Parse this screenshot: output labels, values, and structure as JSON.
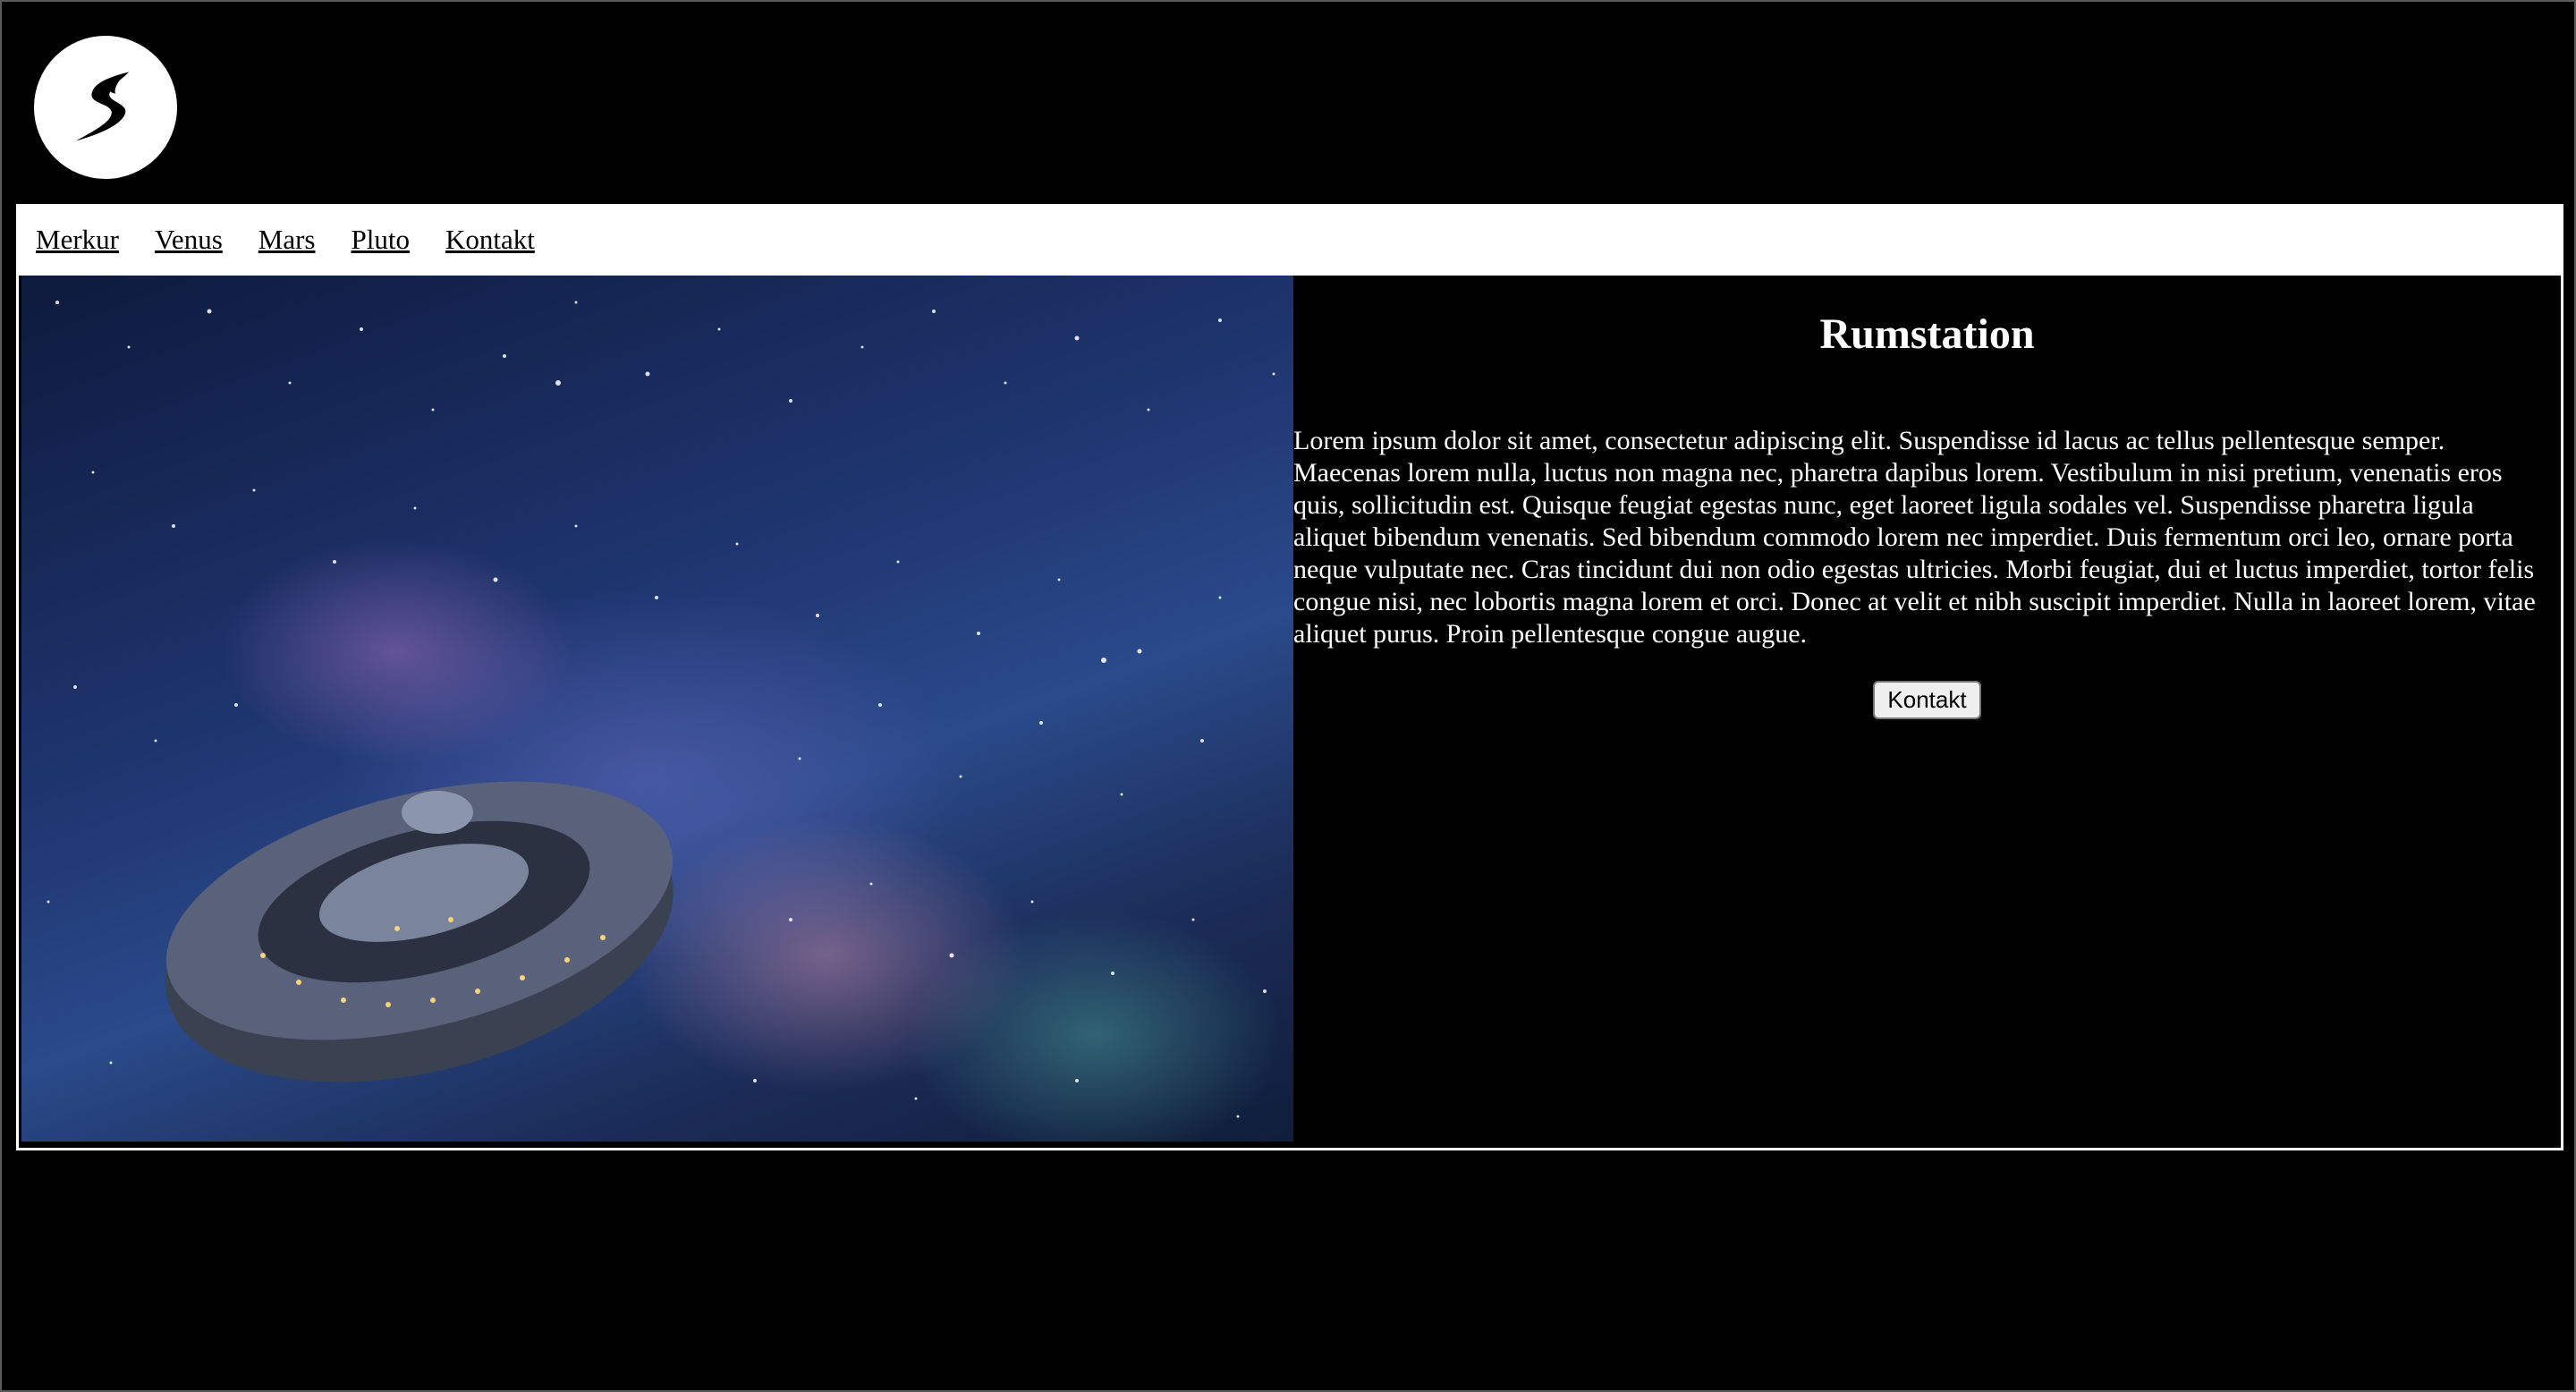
{
  "logo": {
    "icon": "s-swoosh-logo-icon"
  },
  "nav": {
    "items": [
      {
        "label": "Merkur"
      },
      {
        "label": "Venus"
      },
      {
        "label": "Mars"
      },
      {
        "label": "Pluto"
      },
      {
        "label": "Kontakt"
      }
    ]
  },
  "main": {
    "image_icon": "space-station-image",
    "heading": "Rumstation",
    "body": "Lorem ipsum dolor sit amet, consectetur adipiscing elit. Suspendisse id lacus ac tellus pellentesque semper. Maecenas lorem nulla, luctus non magna nec, pharetra dapibus lorem. Vestibulum in nisi pretium, venenatis eros quis, sollicitudin est. Quisque feugiat egestas nunc, eget laoreet ligula sodales vel. Suspendisse pharetra ligula aliquet bibendum venenatis. Sed bibendum commodo lorem nec imperdiet. Duis fermentum orci leo, ornare porta neque vulputate nec. Cras tincidunt dui non odio egestas ultricies. Morbi feugiat, dui et luctus imperdiet, tortor felis congue nisi, nec lobortis magna lorem et orci. Donec at velit et nibh suscipit imperdiet. Nulla in laoreet lorem, vitae aliquet purus. Proin pellentesque congue augue.",
    "button_label": "Kontakt"
  },
  "colors": {
    "page_bg": "#000000",
    "nav_bg": "#ffffff",
    "text": "#ffffff"
  }
}
